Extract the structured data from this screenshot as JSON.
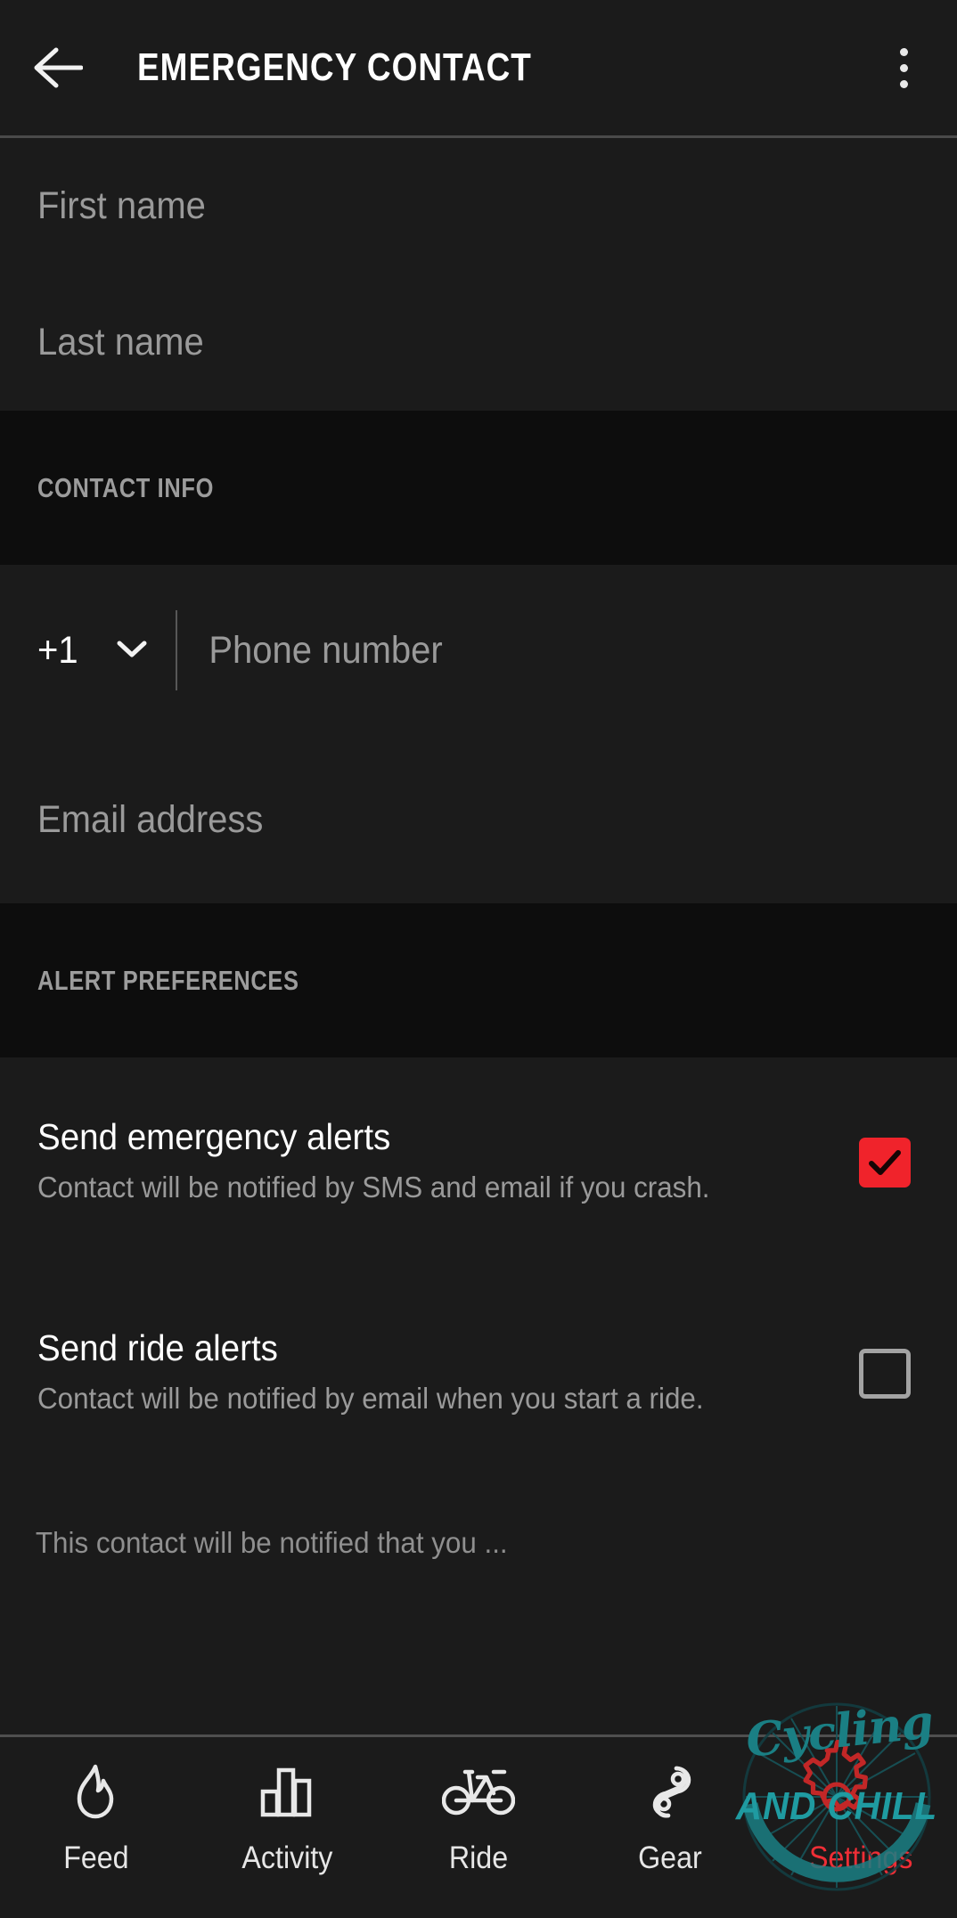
{
  "header": {
    "title": "EMERGENCY CONTACT",
    "back_icon": "arrow-left-icon",
    "overflow_icon": "more-vertical-icon"
  },
  "name_fields": [
    {
      "placeholder": "First name",
      "value": "",
      "name": "first-name"
    },
    {
      "placeholder": "Last name",
      "value": "",
      "name": "last-name"
    }
  ],
  "contact_info": {
    "section_label": "CONTACT INFO",
    "country_code": "+1",
    "country_code_icon": "chevron-down-icon",
    "phone_placeholder": "Phone number",
    "phone_value": "",
    "email_placeholder": "Email address",
    "email_value": ""
  },
  "alert_preferences": {
    "section_label": "ALERT PREFERENCES",
    "items": [
      {
        "title": "Send emergency alerts",
        "description": "Contact will be notified by SMS and email if you crash.",
        "checked": true,
        "checkbox_state": "checked"
      },
      {
        "title": "Send ride alerts",
        "description": "Contact will be notified by email when you start a ride.",
        "checked": false,
        "checkbox_state": "unchecked"
      }
    ],
    "footer_note": "This contact will be notified that you ..."
  },
  "bottom_nav": {
    "items": [
      {
        "label": "Feed",
        "icon": "flame-icon",
        "active": false
      },
      {
        "label": "Activity",
        "icon": "bar-chart-icon",
        "active": false
      },
      {
        "label": "Ride",
        "icon": "bicycle-icon",
        "active": false
      },
      {
        "label": "Gear",
        "icon": "chain-link-icon",
        "active": false
      },
      {
        "label": "Settings",
        "icon": "gear-icon",
        "active": true
      }
    ]
  },
  "watermark": {
    "script_text": "Cycling",
    "bold_text": "AND CHILL",
    "teal": "#1f9ba1",
    "red": "#ef2e36"
  },
  "colors": {
    "background": "#1b1b1b",
    "section_background": "#0d0d0d",
    "accent_red": "#f0232b",
    "text_primary": "#ffffff",
    "text_secondary": "#9a9a9a"
  }
}
